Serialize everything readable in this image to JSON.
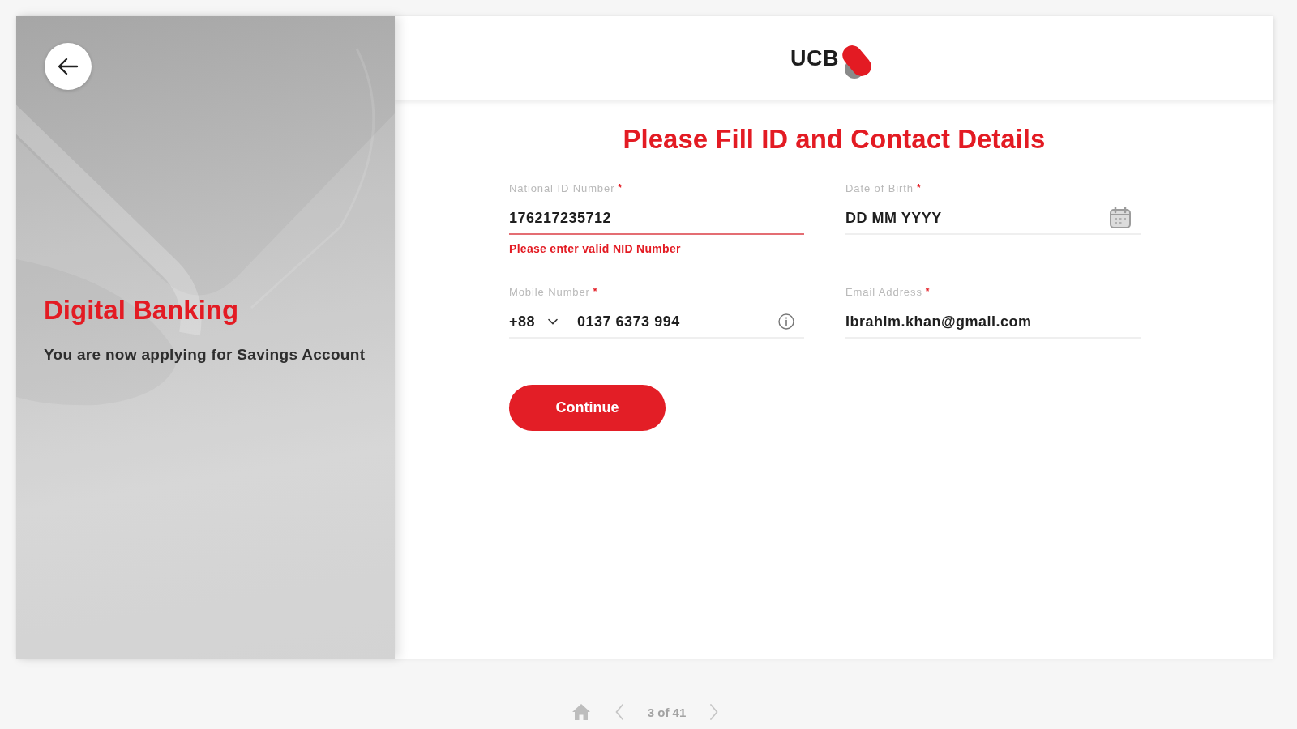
{
  "sidebar": {
    "title": "Digital Banking",
    "subtitle": "You are now applying for Savings Account"
  },
  "header": {
    "logo_text": "UCB"
  },
  "form": {
    "title": "Please Fill ID and Contact Details",
    "fields": [
      {
        "kind": "text",
        "label": "National ID Number",
        "required_mark": "*",
        "value": "176217235712",
        "invalid": true,
        "error": "Please enter valid NID Number"
      },
      {
        "kind": "date",
        "label": "Date of Birth",
        "required_mark": "*",
        "placeholder": "DD MM YYYY",
        "invalid": false
      },
      {
        "kind": "phone",
        "label": "Mobile Number",
        "required_mark": "*",
        "country_code": "+88",
        "value": "0137 6373 994",
        "invalid": false
      },
      {
        "kind": "text",
        "label": "Email Address",
        "required_mark": "*",
        "value": "Ibrahim.khan@gmail.com",
        "invalid": false
      }
    ],
    "submit_label": "Continue"
  },
  "pager": {
    "page_text": "3 of 41"
  }
}
